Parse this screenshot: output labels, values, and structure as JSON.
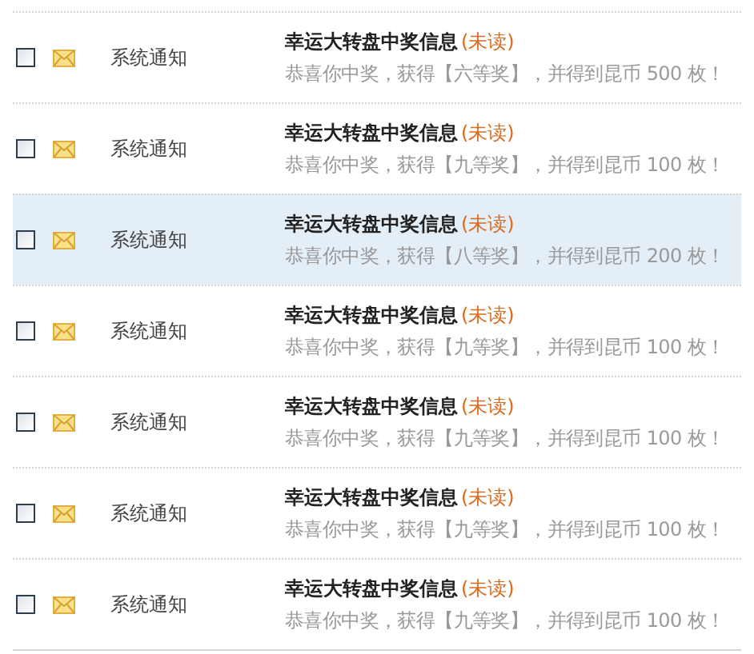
{
  "messages": [
    {
      "checked": false,
      "highlighted": false,
      "sender": "系统通知",
      "title": "幸运大转盘中奖信息",
      "status": "(未读)",
      "body": "恭喜你中奖，获得【六等奖】，并得到昆币 500 枚！"
    },
    {
      "checked": false,
      "highlighted": false,
      "sender": "系统通知",
      "title": "幸运大转盘中奖信息",
      "status": "(未读)",
      "body": "恭喜你中奖，获得【九等奖】，并得到昆币 100 枚！"
    },
    {
      "checked": false,
      "highlighted": true,
      "sender": "系统通知",
      "title": "幸运大转盘中奖信息",
      "status": "(未读)",
      "body": "恭喜你中奖，获得【八等奖】，并得到昆币 200 枚！"
    },
    {
      "checked": false,
      "highlighted": false,
      "sender": "系统通知",
      "title": "幸运大转盘中奖信息",
      "status": "(未读)",
      "body": "恭喜你中奖，获得【九等奖】，并得到昆币 100 枚！"
    },
    {
      "checked": false,
      "highlighted": false,
      "sender": "系统通知",
      "title": "幸运大转盘中奖信息",
      "status": "(未读)",
      "body": "恭喜你中奖，获得【九等奖】，并得到昆币 100 枚！"
    },
    {
      "checked": false,
      "highlighted": false,
      "sender": "系统通知",
      "title": "幸运大转盘中奖信息",
      "status": "(未读)",
      "body": "恭喜你中奖，获得【九等奖】，并得到昆币 100 枚！"
    },
    {
      "checked": false,
      "highlighted": false,
      "sender": "系统通知",
      "title": "幸运大转盘中奖信息",
      "status": "(未读)",
      "body": "恭喜你中奖，获得【九等奖】，并得到昆币 100 枚！"
    }
  ]
}
